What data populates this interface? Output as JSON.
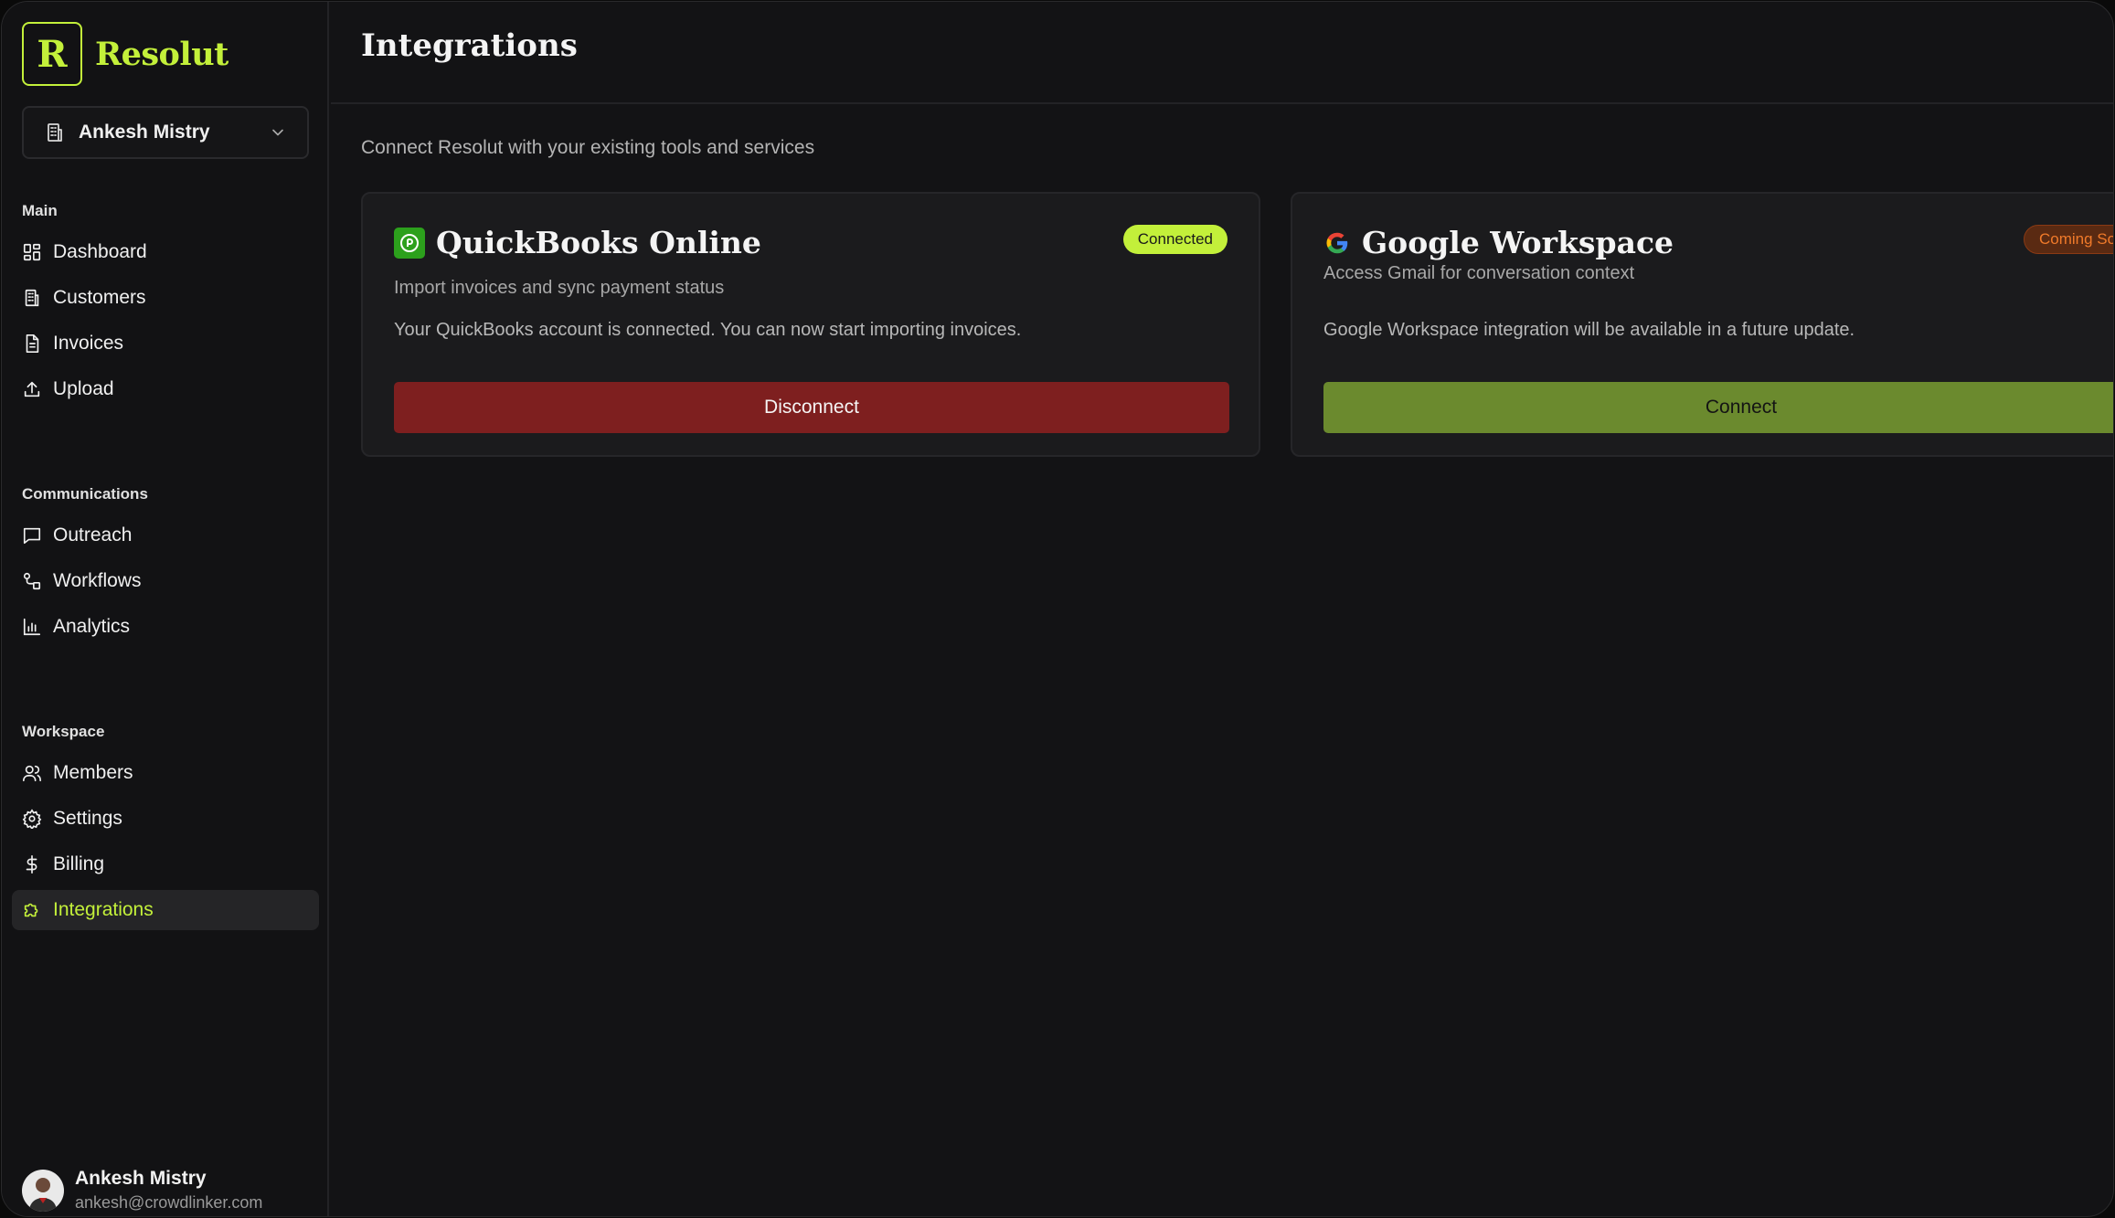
{
  "brand": {
    "logo_letter": "R",
    "name": "Resolut",
    "accent": "#c3f03a"
  },
  "org_selector": {
    "value": "Ankesh Mistry",
    "icon": "building-icon"
  },
  "sidebar": {
    "sections": [
      {
        "label": "Main",
        "items": [
          {
            "label": "Dashboard",
            "icon": "dashboard-icon"
          },
          {
            "label": "Customers",
            "icon": "building-icon"
          },
          {
            "label": "Invoices",
            "icon": "file-icon"
          },
          {
            "label": "Upload",
            "icon": "upload-icon"
          }
        ]
      },
      {
        "label": "Communications",
        "items": [
          {
            "label": "Outreach",
            "icon": "message-icon"
          },
          {
            "label": "Workflows",
            "icon": "workflow-icon"
          },
          {
            "label": "Analytics",
            "icon": "bar-chart-icon"
          }
        ]
      },
      {
        "label": "Workspace",
        "items": [
          {
            "label": "Members",
            "icon": "users-icon"
          },
          {
            "label": "Settings",
            "icon": "gear-icon"
          },
          {
            "label": "Billing",
            "icon": "dollar-icon"
          },
          {
            "label": "Integrations",
            "icon": "puzzle-icon",
            "active": true
          }
        ]
      }
    ]
  },
  "user": {
    "name": "Ankesh Mistry",
    "email": "ankesh@crowdlinker.com"
  },
  "page": {
    "title": "Integrations",
    "subtitle": "Connect Resolut with your existing tools and services"
  },
  "integrations": [
    {
      "name": "QuickBooks Online",
      "icon": "quickbooks-icon",
      "badge": "Connected",
      "badge_color": "#c3f03a",
      "description": "Import invoices and sync payment status",
      "note": "Your QuickBooks account is connected. You can now start importing invoices.",
      "action": "Disconnect",
      "action_color": "#7e1f1f"
    },
    {
      "name": "Google Workspace",
      "icon": "google-icon",
      "badge": "Coming Soon",
      "badge_color": "#8a3a14",
      "description": "Access Gmail for conversation context",
      "note": "Google Workspace integration will be available in a future update.",
      "action": "Connect",
      "action_color": "#6b8a2e"
    }
  ]
}
